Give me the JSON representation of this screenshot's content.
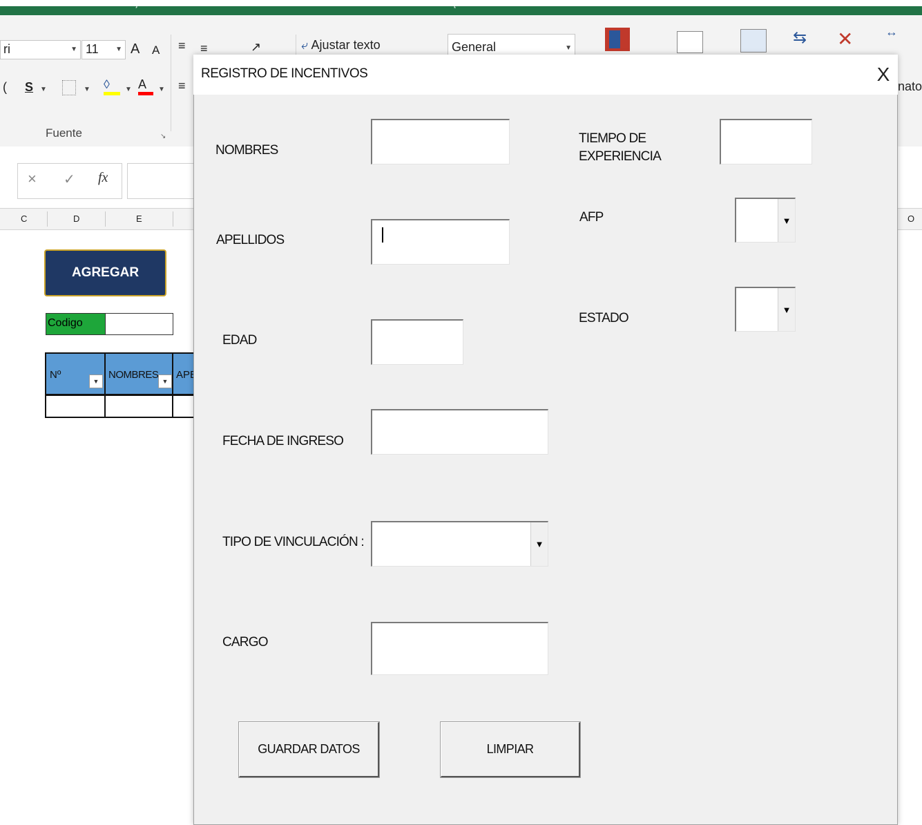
{
  "excel": {
    "title_fragments": [
      "r j",
      "• [ •"
    ],
    "font_name": "ri",
    "font_size": "11",
    "grow_font": "A",
    "shrink_font": "A",
    "underline": "S",
    "fill_color_glyph": "◊",
    "font_color_glyph": "A",
    "wrap_text": "Ajustar texto",
    "number_format": "General",
    "format_fragment": "nato",
    "group_fuente": "Fuente",
    "cancel_symbol": "×",
    "enter_symbol": "✓",
    "fx_symbol": "fx",
    "columns": [
      "C",
      "D",
      "E",
      "O"
    ],
    "agregar_label": "AGREGAR",
    "codigo_label": "Codigo",
    "table_headers": [
      "Nº",
      "NOMBRES",
      "APE"
    ],
    "colors": {
      "excel_green": "#217346",
      "button_navy": "#1f3864",
      "button_border": "#c9a227",
      "codigo_green": "#1ea63a",
      "header_blue": "#5b9bd5"
    }
  },
  "dialog": {
    "title": "REGISTRO DE INCENTIVOS",
    "close_symbol": "X",
    "labels": {
      "nombres": "NOMBRES",
      "apellidos": "APELLIDOS",
      "edad": "EDAD",
      "fecha_ingreso": "FECHA DE INGRESO",
      "tipo_vinculacion": "TIPO DE VINCULACIÓN :",
      "cargo": "CARGO",
      "tiempo_experiencia_1": "TIEMPO DE",
      "tiempo_experiencia_2": "EXPERIENCIA",
      "afp": "AFP",
      "estado": "ESTADO"
    },
    "values": {
      "nombres": "",
      "apellidos": "",
      "edad": "",
      "fecha_ingreso": "",
      "tipo_vinculacion": "",
      "cargo": "",
      "tiempo_experiencia": "",
      "afp": "",
      "estado": ""
    },
    "dropdown_arrow": "▼",
    "buttons": {
      "guardar": "GUARDAR DATOS",
      "limpiar": "LIMPIAR"
    }
  }
}
